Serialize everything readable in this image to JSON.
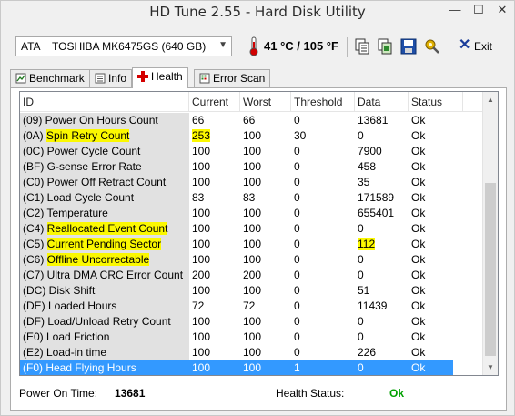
{
  "window": {
    "title": "HD Tune 2.55 - Hard Disk Utility",
    "minimize": "—",
    "maximize": "☐",
    "close": "✕"
  },
  "toolbar": {
    "drive": "ATA    TOSHIBA MK6475GS (640 GB)",
    "temperature": "41 °C / 105 °F",
    "exit_label": "Exit",
    "icons": [
      "copy-info-icon",
      "copy-screenshot-icon",
      "save-icon",
      "options-icon"
    ]
  },
  "tabs": [
    {
      "label": "Benchmark",
      "icon": "benchmark-icon"
    },
    {
      "label": "Info",
      "icon": "info-icon"
    },
    {
      "label": "Health",
      "icon": "health-cross-icon",
      "active": true
    },
    {
      "label": "Error Scan",
      "icon": "error-scan-icon"
    }
  ],
  "table": {
    "headers": [
      "ID",
      "Current",
      "Worst",
      "Threshold",
      "Data",
      "Status"
    ],
    "rows": [
      {
        "id": "(09) Power On Hours Count",
        "current": "66",
        "worst": "66",
        "threshold": "0",
        "data": "13681",
        "status": "Ok"
      },
      {
        "id": "(0A) Spin Retry Count",
        "id_prefix": "(0A) ",
        "id_hl": "Spin Retry Count",
        "current": "253",
        "current_hl": true,
        "worst": "100",
        "threshold": "30",
        "data": "0",
        "status": "Ok"
      },
      {
        "id": "(0C) Power Cycle Count",
        "current": "100",
        "worst": "100",
        "threshold": "0",
        "data": "7900",
        "status": "Ok"
      },
      {
        "id": "(BF) G-sense Error Rate",
        "current": "100",
        "worst": "100",
        "threshold": "0",
        "data": "458",
        "status": "Ok"
      },
      {
        "id": "(C0) Power Off Retract Count",
        "current": "100",
        "worst": "100",
        "threshold": "0",
        "data": "35",
        "status": "Ok"
      },
      {
        "id": "(C1) Load Cycle Count",
        "current": "83",
        "worst": "83",
        "threshold": "0",
        "data": "171589",
        "status": "Ok"
      },
      {
        "id": "(C2) Temperature",
        "current": "100",
        "worst": "100",
        "threshold": "0",
        "data": "655401",
        "status": "Ok"
      },
      {
        "id": "(C4) Reallocated Event Count",
        "id_prefix": "(C4) ",
        "id_hl": "Reallocated Event Count",
        "current": "100",
        "worst": "100",
        "threshold": "0",
        "data": "0",
        "status": "Ok"
      },
      {
        "id": "(C5) Current Pending Sector",
        "id_prefix": "(C5) ",
        "id_hl": "Current Pending Sector",
        "current": "100",
        "worst": "100",
        "threshold": "0",
        "data": "112",
        "data_hl": true,
        "status": "Ok"
      },
      {
        "id": "(C6) Offline Uncorrectable",
        "id_prefix": "(C6) ",
        "id_hl": "Offline Uncorrectable",
        "current": "100",
        "worst": "100",
        "threshold": "0",
        "data": "0",
        "status": "Ok"
      },
      {
        "id": "(C7) Ultra DMA CRC Error Count",
        "current": "200",
        "worst": "200",
        "threshold": "0",
        "data": "0",
        "status": "Ok"
      },
      {
        "id": "(DC) Disk Shift",
        "current": "100",
        "worst": "100",
        "threshold": "0",
        "data": "51",
        "status": "Ok"
      },
      {
        "id": "(DE) Loaded Hours",
        "current": "72",
        "worst": "72",
        "threshold": "0",
        "data": "11439",
        "status": "Ok"
      },
      {
        "id": "(DF) Load/Unload Retry Count",
        "current": "100",
        "worst": "100",
        "threshold": "0",
        "data": "0",
        "status": "Ok"
      },
      {
        "id": "(E0) Load Friction",
        "current": "100",
        "worst": "100",
        "threshold": "0",
        "data": "0",
        "status": "Ok"
      },
      {
        "id": "(E2) Load-in time",
        "current": "100",
        "worst": "100",
        "threshold": "0",
        "data": "226",
        "status": "Ok"
      },
      {
        "id": "(F0) Head Flying Hours",
        "current": "100",
        "worst": "100",
        "threshold": "1",
        "data": "0",
        "status": "Ok",
        "selected": true
      }
    ]
  },
  "footer": {
    "power_on_label": "Power On Time:",
    "power_on_value": "13681",
    "health_label": "Health Status:",
    "health_value": "Ok",
    "health_color": "#00a000"
  },
  "colors": {
    "highlight": "#fbf800",
    "selection": "#3399ff",
    "id_column_bg": "#e1e1e1"
  }
}
